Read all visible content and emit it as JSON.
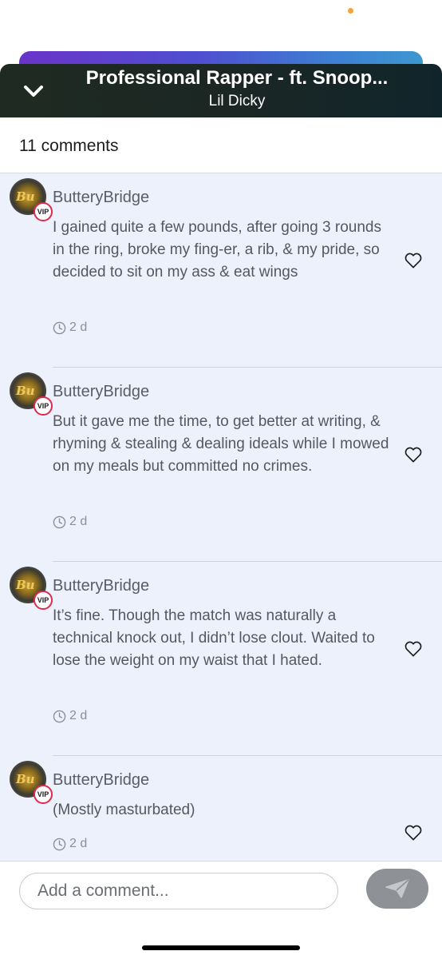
{
  "header": {
    "title": "Professional Rapper - ft. Snoop...",
    "artist": "Lil Dicky"
  },
  "comments_count_label": "11 comments",
  "comments": [
    {
      "username": "ButteryBridge",
      "badge": "VIP",
      "text": "I gained quite a few pounds, after going 3 rounds in the ring, broke my fing-er, a rib, & my pride, so decided to sit on my ass & eat wings",
      "time": "2 d"
    },
    {
      "username": "ButteryBridge",
      "badge": "VIP",
      "text": "But it gave me the time, to get better at writing, & rhyming & stealing & dealing ideals while I mowed on my meals but committed no crimes.",
      "time": "2 d"
    },
    {
      "username": "ButteryBridge",
      "badge": "VIP",
      "text": "It’s fine. Though the match was naturally a technical knock out, I didn’t lose clout. Waited to lose the weight on my waist that I hated.",
      "time": "2 d"
    },
    {
      "username": "ButteryBridge",
      "badge": "VIP",
      "text": "(Mostly masturbated)",
      "time": "2 d"
    }
  ],
  "footer": {
    "input_placeholder": "Add a comment...",
    "input_value": ""
  },
  "colors": {
    "header_bg": "#1c2724",
    "comments_bg": "#edf1fb",
    "vip_ring": "#e0294f",
    "send_button": "#8e9196",
    "status_dot": "#f5a33b"
  },
  "icons": {
    "collapse": "chevron-down-icon",
    "like": "heart-outline-icon",
    "time": "clock-icon",
    "send": "paper-plane-icon"
  }
}
